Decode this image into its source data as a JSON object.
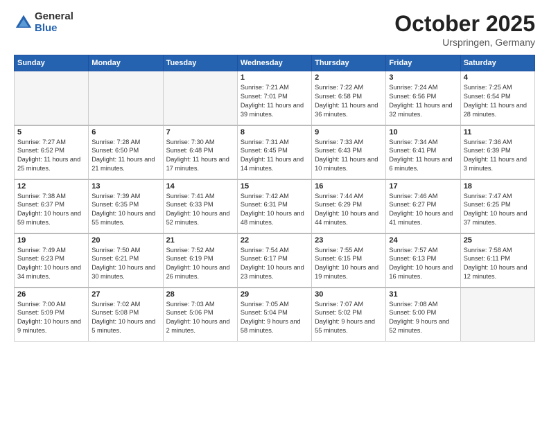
{
  "header": {
    "logo_general": "General",
    "logo_blue": "Blue",
    "month": "October 2025",
    "location": "Urspringen, Germany"
  },
  "days_of_week": [
    "Sunday",
    "Monday",
    "Tuesday",
    "Wednesday",
    "Thursday",
    "Friday",
    "Saturday"
  ],
  "weeks": [
    [
      {
        "day": "",
        "info": ""
      },
      {
        "day": "",
        "info": ""
      },
      {
        "day": "",
        "info": ""
      },
      {
        "day": "1",
        "info": "Sunrise: 7:21 AM\nSunset: 7:01 PM\nDaylight: 11 hours\nand 39 minutes."
      },
      {
        "day": "2",
        "info": "Sunrise: 7:22 AM\nSunset: 6:58 PM\nDaylight: 11 hours\nand 36 minutes."
      },
      {
        "day": "3",
        "info": "Sunrise: 7:24 AM\nSunset: 6:56 PM\nDaylight: 11 hours\nand 32 minutes."
      },
      {
        "day": "4",
        "info": "Sunrise: 7:25 AM\nSunset: 6:54 PM\nDaylight: 11 hours\nand 28 minutes."
      }
    ],
    [
      {
        "day": "5",
        "info": "Sunrise: 7:27 AM\nSunset: 6:52 PM\nDaylight: 11 hours\nand 25 minutes."
      },
      {
        "day": "6",
        "info": "Sunrise: 7:28 AM\nSunset: 6:50 PM\nDaylight: 11 hours\nand 21 minutes."
      },
      {
        "day": "7",
        "info": "Sunrise: 7:30 AM\nSunset: 6:48 PM\nDaylight: 11 hours\nand 17 minutes."
      },
      {
        "day": "8",
        "info": "Sunrise: 7:31 AM\nSunset: 6:45 PM\nDaylight: 11 hours\nand 14 minutes."
      },
      {
        "day": "9",
        "info": "Sunrise: 7:33 AM\nSunset: 6:43 PM\nDaylight: 11 hours\nand 10 minutes."
      },
      {
        "day": "10",
        "info": "Sunrise: 7:34 AM\nSunset: 6:41 PM\nDaylight: 11 hours\nand 6 minutes."
      },
      {
        "day": "11",
        "info": "Sunrise: 7:36 AM\nSunset: 6:39 PM\nDaylight: 11 hours\nand 3 minutes."
      }
    ],
    [
      {
        "day": "12",
        "info": "Sunrise: 7:38 AM\nSunset: 6:37 PM\nDaylight: 10 hours\nand 59 minutes."
      },
      {
        "day": "13",
        "info": "Sunrise: 7:39 AM\nSunset: 6:35 PM\nDaylight: 10 hours\nand 55 minutes."
      },
      {
        "day": "14",
        "info": "Sunrise: 7:41 AM\nSunset: 6:33 PM\nDaylight: 10 hours\nand 52 minutes."
      },
      {
        "day": "15",
        "info": "Sunrise: 7:42 AM\nSunset: 6:31 PM\nDaylight: 10 hours\nand 48 minutes."
      },
      {
        "day": "16",
        "info": "Sunrise: 7:44 AM\nSunset: 6:29 PM\nDaylight: 10 hours\nand 44 minutes."
      },
      {
        "day": "17",
        "info": "Sunrise: 7:46 AM\nSunset: 6:27 PM\nDaylight: 10 hours\nand 41 minutes."
      },
      {
        "day": "18",
        "info": "Sunrise: 7:47 AM\nSunset: 6:25 PM\nDaylight: 10 hours\nand 37 minutes."
      }
    ],
    [
      {
        "day": "19",
        "info": "Sunrise: 7:49 AM\nSunset: 6:23 PM\nDaylight: 10 hours\nand 34 minutes."
      },
      {
        "day": "20",
        "info": "Sunrise: 7:50 AM\nSunset: 6:21 PM\nDaylight: 10 hours\nand 30 minutes."
      },
      {
        "day": "21",
        "info": "Sunrise: 7:52 AM\nSunset: 6:19 PM\nDaylight: 10 hours\nand 26 minutes."
      },
      {
        "day": "22",
        "info": "Sunrise: 7:54 AM\nSunset: 6:17 PM\nDaylight: 10 hours\nand 23 minutes."
      },
      {
        "day": "23",
        "info": "Sunrise: 7:55 AM\nSunset: 6:15 PM\nDaylight: 10 hours\nand 19 minutes."
      },
      {
        "day": "24",
        "info": "Sunrise: 7:57 AM\nSunset: 6:13 PM\nDaylight: 10 hours\nand 16 minutes."
      },
      {
        "day": "25",
        "info": "Sunrise: 7:58 AM\nSunset: 6:11 PM\nDaylight: 10 hours\nand 12 minutes."
      }
    ],
    [
      {
        "day": "26",
        "info": "Sunrise: 7:00 AM\nSunset: 5:09 PM\nDaylight: 10 hours\nand 9 minutes."
      },
      {
        "day": "27",
        "info": "Sunrise: 7:02 AM\nSunset: 5:08 PM\nDaylight: 10 hours\nand 5 minutes."
      },
      {
        "day": "28",
        "info": "Sunrise: 7:03 AM\nSunset: 5:06 PM\nDaylight: 10 hours\nand 2 minutes."
      },
      {
        "day": "29",
        "info": "Sunrise: 7:05 AM\nSunset: 5:04 PM\nDaylight: 9 hours\nand 58 minutes."
      },
      {
        "day": "30",
        "info": "Sunrise: 7:07 AM\nSunset: 5:02 PM\nDaylight: 9 hours\nand 55 minutes."
      },
      {
        "day": "31",
        "info": "Sunrise: 7:08 AM\nSunset: 5:00 PM\nDaylight: 9 hours\nand 52 minutes."
      },
      {
        "day": "",
        "info": ""
      }
    ]
  ]
}
